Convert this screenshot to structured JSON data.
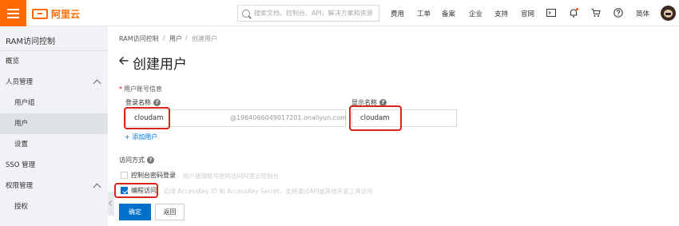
{
  "topbar": {
    "logo_text": "阿里云",
    "search_placeholder": "搜索文档、控制台、API、解决方案和资源",
    "nav": [
      "费用",
      "工单",
      "备案",
      "企业",
      "支持",
      "官网"
    ],
    "language": "简体",
    "accent_color": "#ff6a00"
  },
  "sidebar": {
    "title": "RAM访问控制",
    "items": [
      {
        "label": "概览"
      },
      {
        "label": "人员管理"
      },
      {
        "label": "用户组"
      },
      {
        "label": "用户"
      },
      {
        "label": "设置"
      },
      {
        "label": "SSO 管理"
      },
      {
        "label": "权限管理"
      },
      {
        "label": "授权"
      }
    ]
  },
  "breadcrumb": {
    "items": [
      "RAM访问控制",
      "用户",
      "创建用户"
    ],
    "separator": "/"
  },
  "page": {
    "title": "创建用户",
    "section_label": "用户账号信息",
    "login_name_label": "登录名称",
    "login_name_value": "cloudam",
    "login_suffix": "@1964066049017201.onaliyun.com",
    "display_name_label": "显示名称",
    "display_name_value": "cloudam",
    "add_user": "添加用户",
    "access_label": "访问方式",
    "options": [
      {
        "label": "控制台密码登录",
        "desc": "用户使用账号密码访问阿里云控制台",
        "checked": false
      },
      {
        "label": "编程访问",
        "desc": "启用 AccessKey ID 和 AccessKey Secret，支持通过API或其他开发工具访问",
        "checked": true
      }
    ],
    "confirm": "确定",
    "back": "返回",
    "primary_color": "#0070cc",
    "highlight_color": "#d9261c"
  }
}
